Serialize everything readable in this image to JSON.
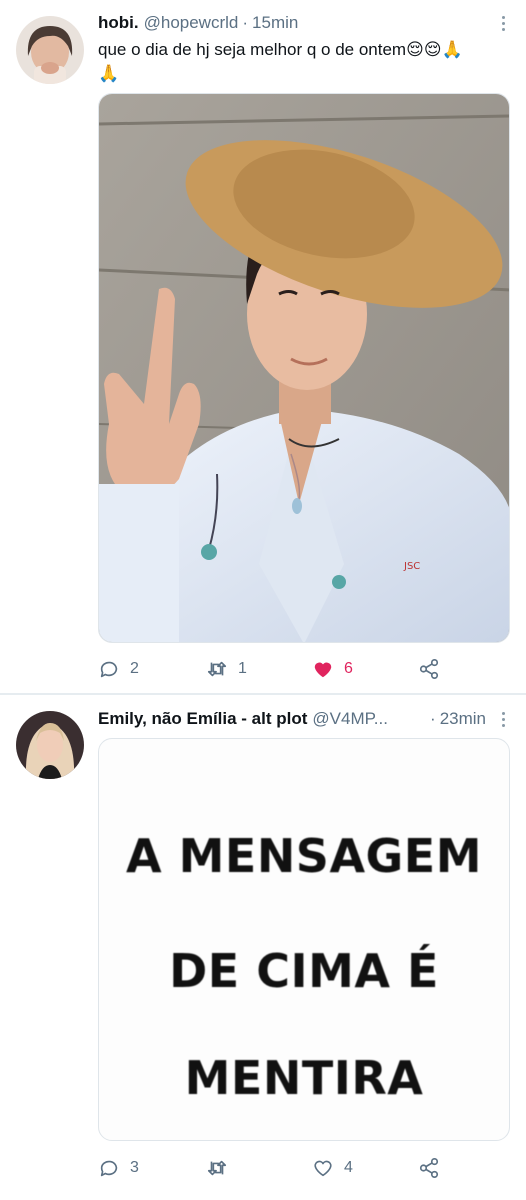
{
  "tweets": [
    {
      "name": "hobi.",
      "handle": "@hopewcrld",
      "separator": "·",
      "time": "15min",
      "text": "que o dia de hj seja melhor q o de ontem",
      "emojis": [
        "relieved-face",
        "relieved-face",
        "folded-hands",
        "folded-hands"
      ],
      "actions": {
        "replies": "2",
        "retweets": "1",
        "likes": "6",
        "liked": true
      }
    },
    {
      "name": "Emily, não Emília - alt plot",
      "handle": "@V4MP...",
      "separator": "·",
      "time": "23min",
      "meme_lines": [
        "A MENSAGEM",
        "DE CIMA É",
        "MENTIRA"
      ],
      "actions": {
        "replies": "3",
        "retweets": "",
        "likes": "4",
        "liked": false
      }
    }
  ],
  "colors": {
    "like_active": "#e0245e",
    "icon_gray": "#5b7083",
    "divider": "#e6ecf0"
  }
}
